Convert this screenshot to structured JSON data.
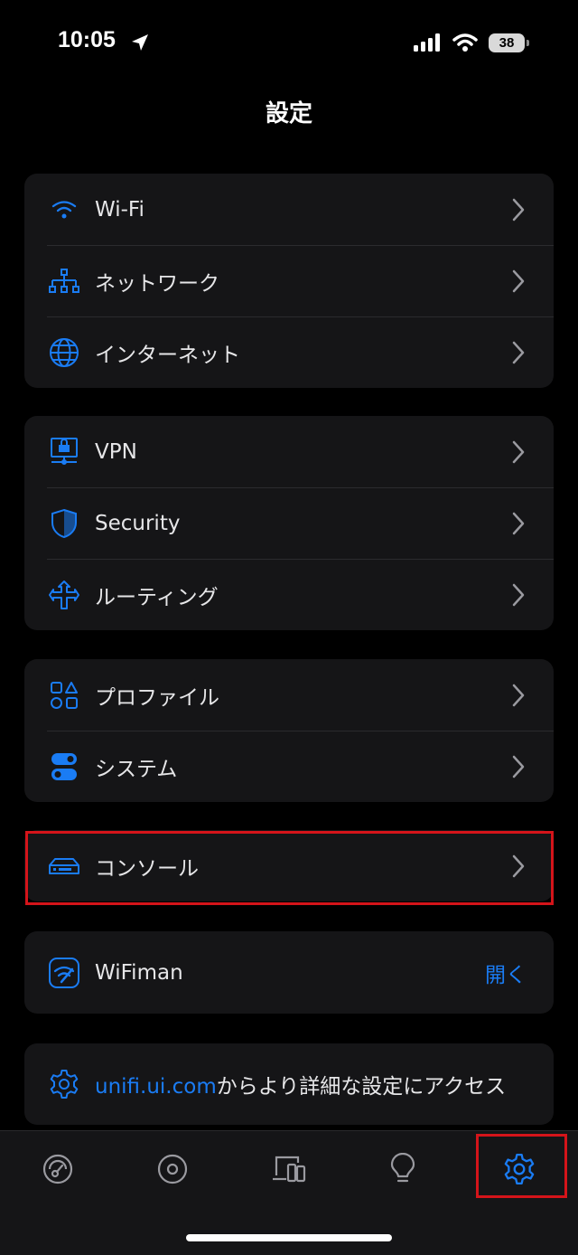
{
  "status_bar": {
    "time": "10:05",
    "battery": "38"
  },
  "page": {
    "title": "設定"
  },
  "groups": {
    "network": [
      {
        "label": "Wi-Fi"
      },
      {
        "label": "ネットワーク"
      },
      {
        "label": "インターネット"
      }
    ],
    "security": [
      {
        "label": "VPN"
      },
      {
        "label": "Security"
      },
      {
        "label": "ルーティング"
      }
    ],
    "system": [
      {
        "label": "プロファイル"
      },
      {
        "label": "システム"
      }
    ],
    "console": {
      "label": "コンソール"
    },
    "wifiman": {
      "label": "WiFiman",
      "action": "開く"
    },
    "advanced": {
      "link": "unifi.ui.com",
      "text": "からより詳細な設定にアクセス"
    }
  },
  "tabs": [
    "dashboard",
    "devices",
    "clients",
    "insights",
    "settings"
  ],
  "colors": {
    "accent": "#1a7cf4",
    "highlight": "#d4141a",
    "card": "#151517"
  }
}
